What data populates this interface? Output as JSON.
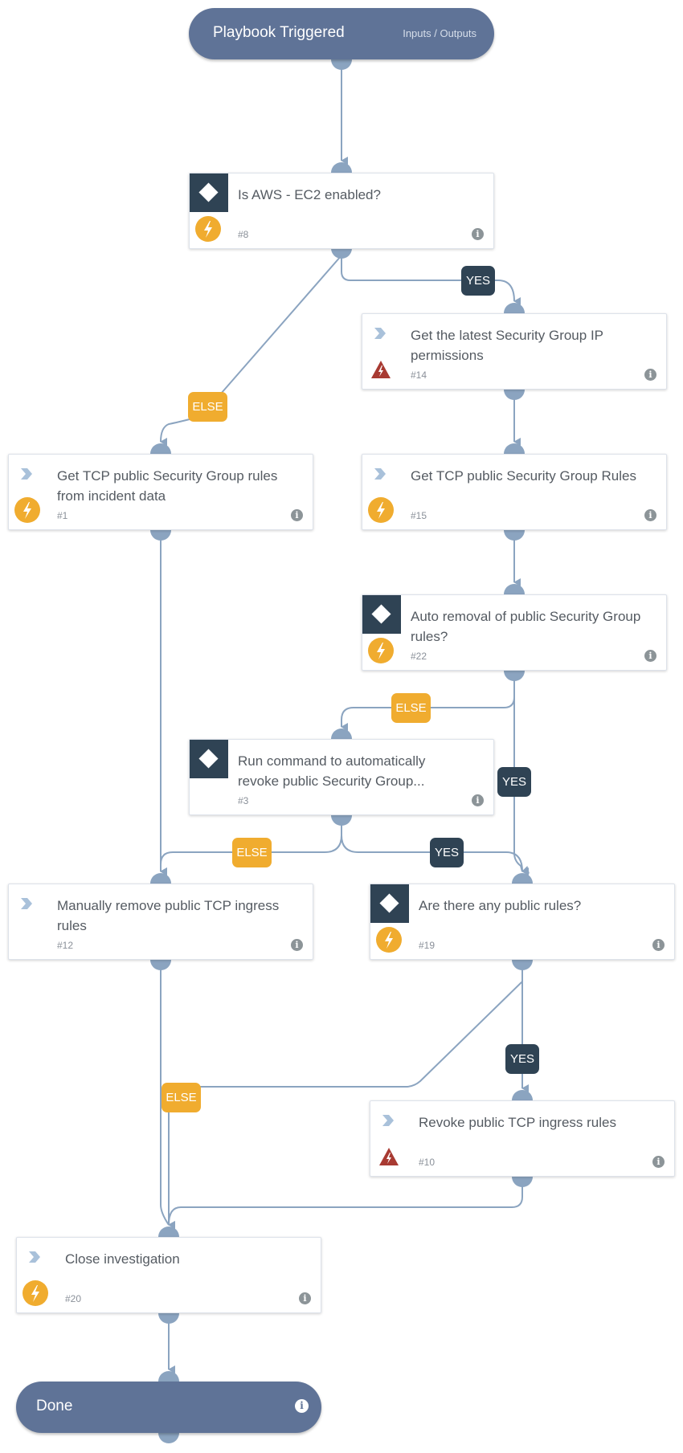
{
  "start": {
    "title": "Playbook Triggered",
    "io_link": "Inputs / Outputs",
    "icon": "none"
  },
  "end": {
    "title": "Done",
    "icon": "info-icon"
  },
  "nodes": [
    {
      "id": "n8",
      "number": "#8",
      "label": "Is AWS - EC2 enabled?",
      "type": "condition",
      "status_icon": "bolt-icon"
    },
    {
      "id": "n14",
      "number": "#14",
      "label": "Get the latest Security Group IP permissions",
      "type": "task",
      "status_icon": "warning-icon"
    },
    {
      "id": "n1",
      "number": "#1",
      "label": "Get TCP public Security Group rules from incident data",
      "type": "task",
      "status_icon": "bolt-icon"
    },
    {
      "id": "n15",
      "number": "#15",
      "label": "Get TCP public Security Group Rules",
      "type": "task",
      "status_icon": "bolt-icon"
    },
    {
      "id": "n22",
      "number": "#22",
      "label": "Auto removal of public Security Group rules?",
      "type": "condition",
      "status_icon": "bolt-icon"
    },
    {
      "id": "n3",
      "number": "#3",
      "label": "Run command to automatically revoke public Security Group...",
      "type": "condition",
      "status_icon": "none"
    },
    {
      "id": "n12",
      "number": "#12",
      "label": "Manually remove public TCP ingress rules",
      "type": "task",
      "status_icon": "none"
    },
    {
      "id": "n19",
      "number": "#19",
      "label": "Are there any public rules?",
      "type": "condition",
      "status_icon": "bolt-icon"
    },
    {
      "id": "n10",
      "number": "#10",
      "label": "Revoke public TCP ingress rules",
      "type": "task",
      "status_icon": "warning-icon"
    },
    {
      "id": "n20",
      "number": "#20",
      "label": "Close investigation",
      "type": "task",
      "status_icon": "bolt-icon"
    }
  ],
  "edges": [
    {
      "from": "start",
      "to": "n8",
      "label": ""
    },
    {
      "from": "n8",
      "to": "n14",
      "label": "YES"
    },
    {
      "from": "n8",
      "to": "n1",
      "label": "ELSE"
    },
    {
      "from": "n14",
      "to": "n15",
      "label": ""
    },
    {
      "from": "n15",
      "to": "n22",
      "label": ""
    },
    {
      "from": "n22",
      "to": "n3",
      "label": "ELSE"
    },
    {
      "from": "n22",
      "to": "n19",
      "label": "YES"
    },
    {
      "from": "n3",
      "to": "n12",
      "label": "ELSE"
    },
    {
      "from": "n3",
      "to": "n19",
      "label": "YES"
    },
    {
      "from": "n1",
      "to": "n12",
      "label": ""
    },
    {
      "from": "n19",
      "to": "n10",
      "label": "YES"
    },
    {
      "from": "n19",
      "to": "n20",
      "label": "ELSE"
    },
    {
      "from": "n12",
      "to": "n20",
      "label": ""
    },
    {
      "from": "n10",
      "to": "n20",
      "label": ""
    },
    {
      "from": "n20",
      "to": "end",
      "label": ""
    }
  ],
  "badges": {
    "yes": "YES",
    "else": "ELSE"
  },
  "colors": {
    "pill": "#5f7397",
    "condition": "#2f4354",
    "bolt": "#f0ac2f",
    "warning": "#a83a32",
    "edge": "#8ba4c0",
    "else": "#f0ac2f",
    "yes": "#2f4354"
  },
  "info_glyph": "i"
}
